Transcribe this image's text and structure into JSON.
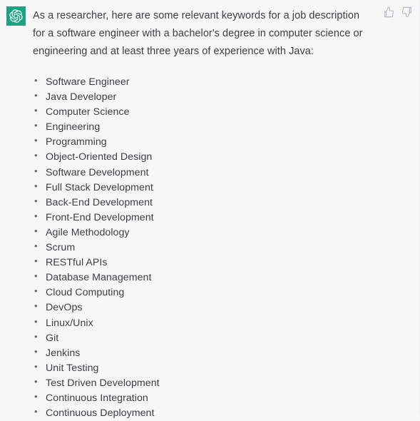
{
  "message": {
    "avatar_icon": "chatgpt-logo-icon",
    "avatar_color": "#19a37f",
    "intro_paragraph": "As a researcher, here are some relevant keywords for a job description for a software engineer with a bachelor's degree in computer science or engineering and at least three years of experience with Java:",
    "keywords": [
      "Software Engineer",
      "Java Developer",
      "Computer Science",
      "Engineering",
      "Programming",
      "Object-Oriented Design",
      "Software Development",
      "Full Stack Development",
      "Back-End Development",
      "Front-End Development",
      "Agile Methodology",
      "Scrum",
      "RESTful APIs",
      "Database Management",
      "Cloud Computing",
      "DevOps",
      "Linux/Unix",
      "Git",
      "Jenkins",
      "Unit Testing",
      "Test Driven Development",
      "Continuous Integration",
      "Continuous Deployment"
    ],
    "bullet_glyph": "•"
  },
  "feedback": {
    "thumbs_up_icon": "thumbs-up-icon",
    "thumbs_down_icon": "thumbs-down-icon",
    "icon_color": "#b4b4c4"
  },
  "theme": {
    "background": "#f7f7f8",
    "text_color": "#3c4043"
  }
}
